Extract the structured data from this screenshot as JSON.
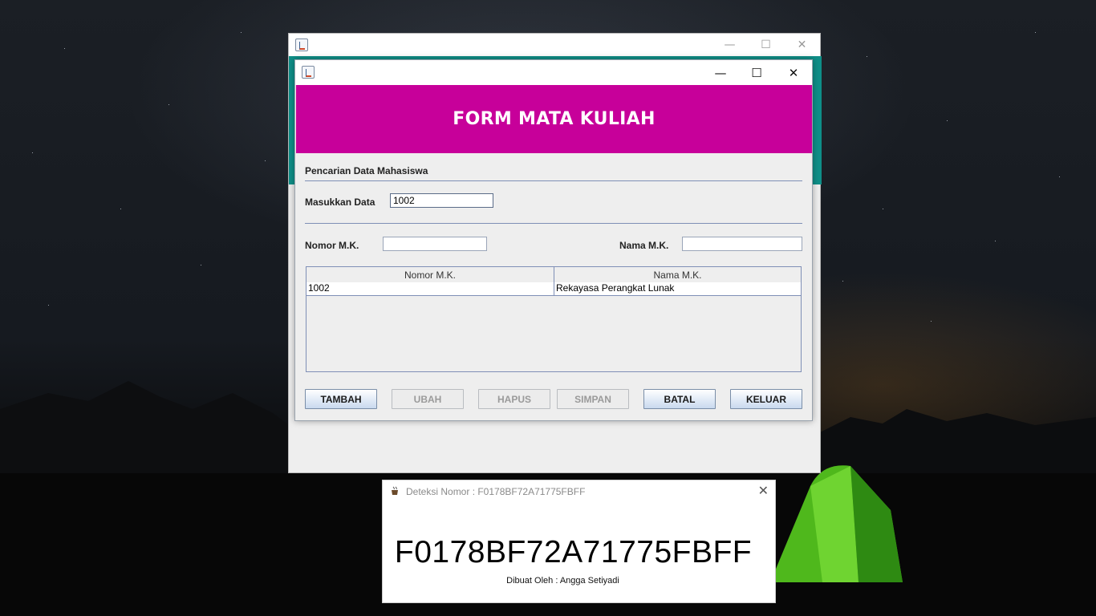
{
  "popup": {
    "title": "Deteksi Nomor : F0178BF72A71775FBFF",
    "code": "F0178BF72A71775FBFF",
    "credit": "Dibuat Oleh : Angga Setiyadi",
    "close": "✕"
  },
  "form": {
    "title": "FORM MATA KULIAH",
    "section_title": "Pencarian Data Mahasiswa",
    "search_label": "Masukkan Data",
    "search_value": "1002",
    "nomor_label": "Nomor M.K.",
    "nomor_value": "",
    "nama_label": "Nama M.K.",
    "nama_value": "",
    "table": {
      "headers": [
        "Nomor M.K.",
        "Nama M.K."
      ],
      "rows": [
        [
          "1002",
          "Rekayasa Perangkat Lunak"
        ]
      ]
    },
    "buttons": {
      "tambah": "TAMBAH",
      "ubah": "UBAH",
      "hapus": "HAPUS",
      "simpan": "SIMPAN",
      "batal": "BATAL",
      "keluar": "KELUAR"
    },
    "caption": {
      "minimize": "—",
      "maximize": "☐",
      "close": "✕"
    }
  },
  "colors": {
    "banner": "#c7009a",
    "teal": "#0f8f88"
  }
}
